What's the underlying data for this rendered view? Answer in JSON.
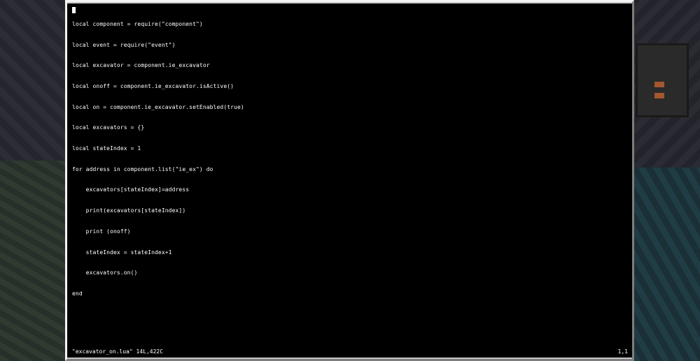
{
  "editor": {
    "lines": [
      "local component = require(\"component\")",
      "local event = require(\"event\")",
      "local excavator = component.ie_excavator",
      "local onoff = component.ie_excavator.isActive()",
      "local on = component.ie_excavator.setEnabled(true)",
      "local excavators = {}",
      "local stateIndex = 1",
      "for address in component.list(\"ie_ex\") do",
      "    excavators[stateIndex]=address",
      "    print(excavators[stateIndex])",
      "    print (onoff)",
      "    stateIndex = stateIndex+1",
      "    excavators.on()",
      "end"
    ],
    "status": {
      "file": "\"excavator_on.lua\" 14L,422C",
      "cursor_position": "1,1"
    }
  },
  "colors": {
    "terminal_background": "#000000",
    "text": "#ffffff",
    "frame": "#c6c6c6"
  }
}
